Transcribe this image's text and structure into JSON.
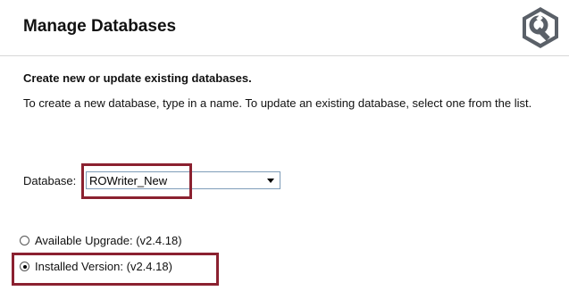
{
  "header": {
    "title": "Manage Databases",
    "logo_icon": "wrench-gear-icon"
  },
  "section": {
    "subtitle": "Create new or update existing databases.",
    "description": "To create a new database, type in a name. To update an existing database, select one from the list."
  },
  "database": {
    "label": "Database:",
    "value": "ROWriter_New",
    "dropdown_icon": "chevron-down-icon"
  },
  "options": {
    "available_upgrade": {
      "label": "Available Upgrade: (v2.4.18)",
      "checked": false
    },
    "installed_version": {
      "label": "Installed Version: (v2.4.18)",
      "checked": true
    }
  },
  "colors": {
    "highlight": "#8b2130"
  }
}
